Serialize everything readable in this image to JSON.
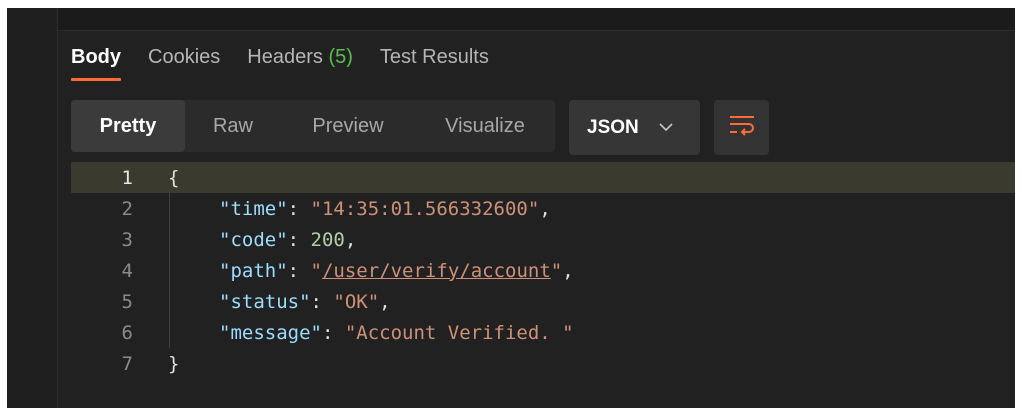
{
  "tabs": [
    {
      "label": "Body",
      "active": true
    },
    {
      "label": "Cookies"
    },
    {
      "label": "Headers",
      "count": "(5)"
    },
    {
      "label": "Test Results"
    }
  ],
  "view_modes": [
    "Pretty",
    "Raw",
    "Preview",
    "Visualize"
  ],
  "active_view": "Pretty",
  "format_select": {
    "value": "JSON"
  },
  "icons": {
    "chevron": "chevron-down-icon",
    "wrap": "word-wrap-icon"
  },
  "colors": {
    "accent": "#ff6c37",
    "count": "#5cbd4f",
    "key": "#9cdcfe",
    "string": "#ce9178",
    "number": "#b5cea8",
    "background": "#212121"
  },
  "response": {
    "line_numbers": [
      "1",
      "2",
      "3",
      "4",
      "5",
      "6",
      "7"
    ],
    "open_brace": "{",
    "close_brace": "}",
    "fields": [
      {
        "key": "\"time\"",
        "sep": ": ",
        "value": "\"14:35:01.566332600\"",
        "trail": ",",
        "type": "string"
      },
      {
        "key": "\"code\"",
        "sep": ": ",
        "value": "200",
        "trail": ",",
        "type": "number"
      },
      {
        "key": "\"path\"",
        "sep": ": ",
        "value_open": "\"",
        "value": "/user/verify/account",
        "value_close": "\"",
        "trail": ",",
        "type": "url"
      },
      {
        "key": "\"status\"",
        "sep": ": ",
        "value": "\"OK\"",
        "trail": ",",
        "type": "string"
      },
      {
        "key": "\"message\"",
        "sep": ": ",
        "value": "\"Account Verified. \"",
        "trail": "",
        "type": "string"
      }
    ]
  }
}
